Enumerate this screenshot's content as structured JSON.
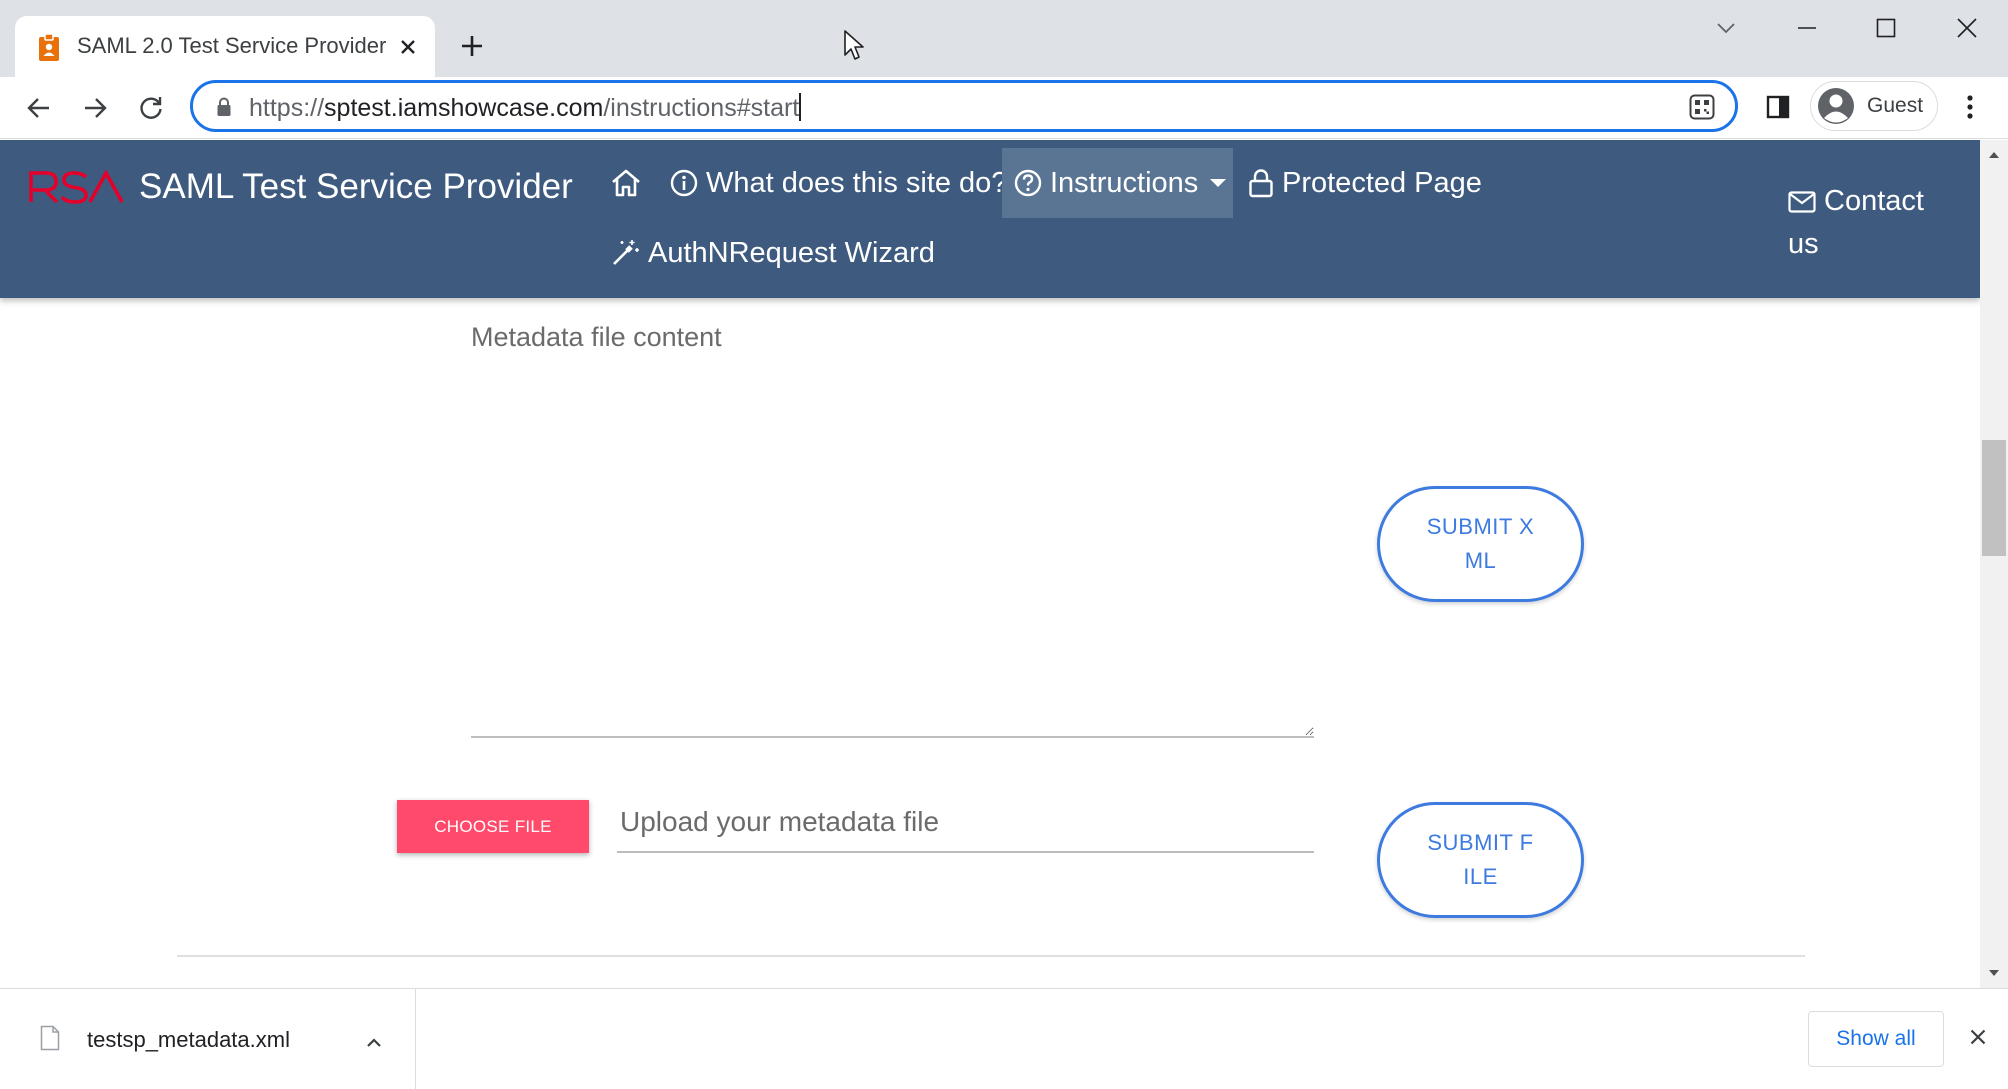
{
  "browser": {
    "tab": {
      "title": "SAML 2.0 Test Service Provider",
      "favicon": "badge-icon"
    },
    "omnibox": {
      "scheme": "https://",
      "host": "sptest.iamshowcase.com",
      "path": "/instructions#start"
    },
    "profile": {
      "label": "Guest"
    }
  },
  "site": {
    "brand": {
      "logo_text": "RSA",
      "title": "SAML Test Service Provider"
    },
    "nav": {
      "home_icon": "home-icon",
      "what": "What does this site do?",
      "instructions": "Instructions",
      "protected": "Protected Page",
      "wizard": "AuthNRequest Wizard",
      "contact_line1": "Contact",
      "contact_line2": "us"
    },
    "colors": {
      "navbar": "#3e5b7f",
      "accent": "#3d7be0",
      "choose_button": "#ff4a6b",
      "rsa_red": "#e4002b"
    }
  },
  "form": {
    "metadata_label": "Metadata file content",
    "submit_xml": "SUBMIT XML",
    "choose_file": "CHOOSE FILE",
    "upload_placeholder": "Upload your metadata file",
    "submit_file": "SUBMIT FILE"
  },
  "downloads": {
    "file_name": "testsp_metadata.xml",
    "show_all": "Show all"
  }
}
